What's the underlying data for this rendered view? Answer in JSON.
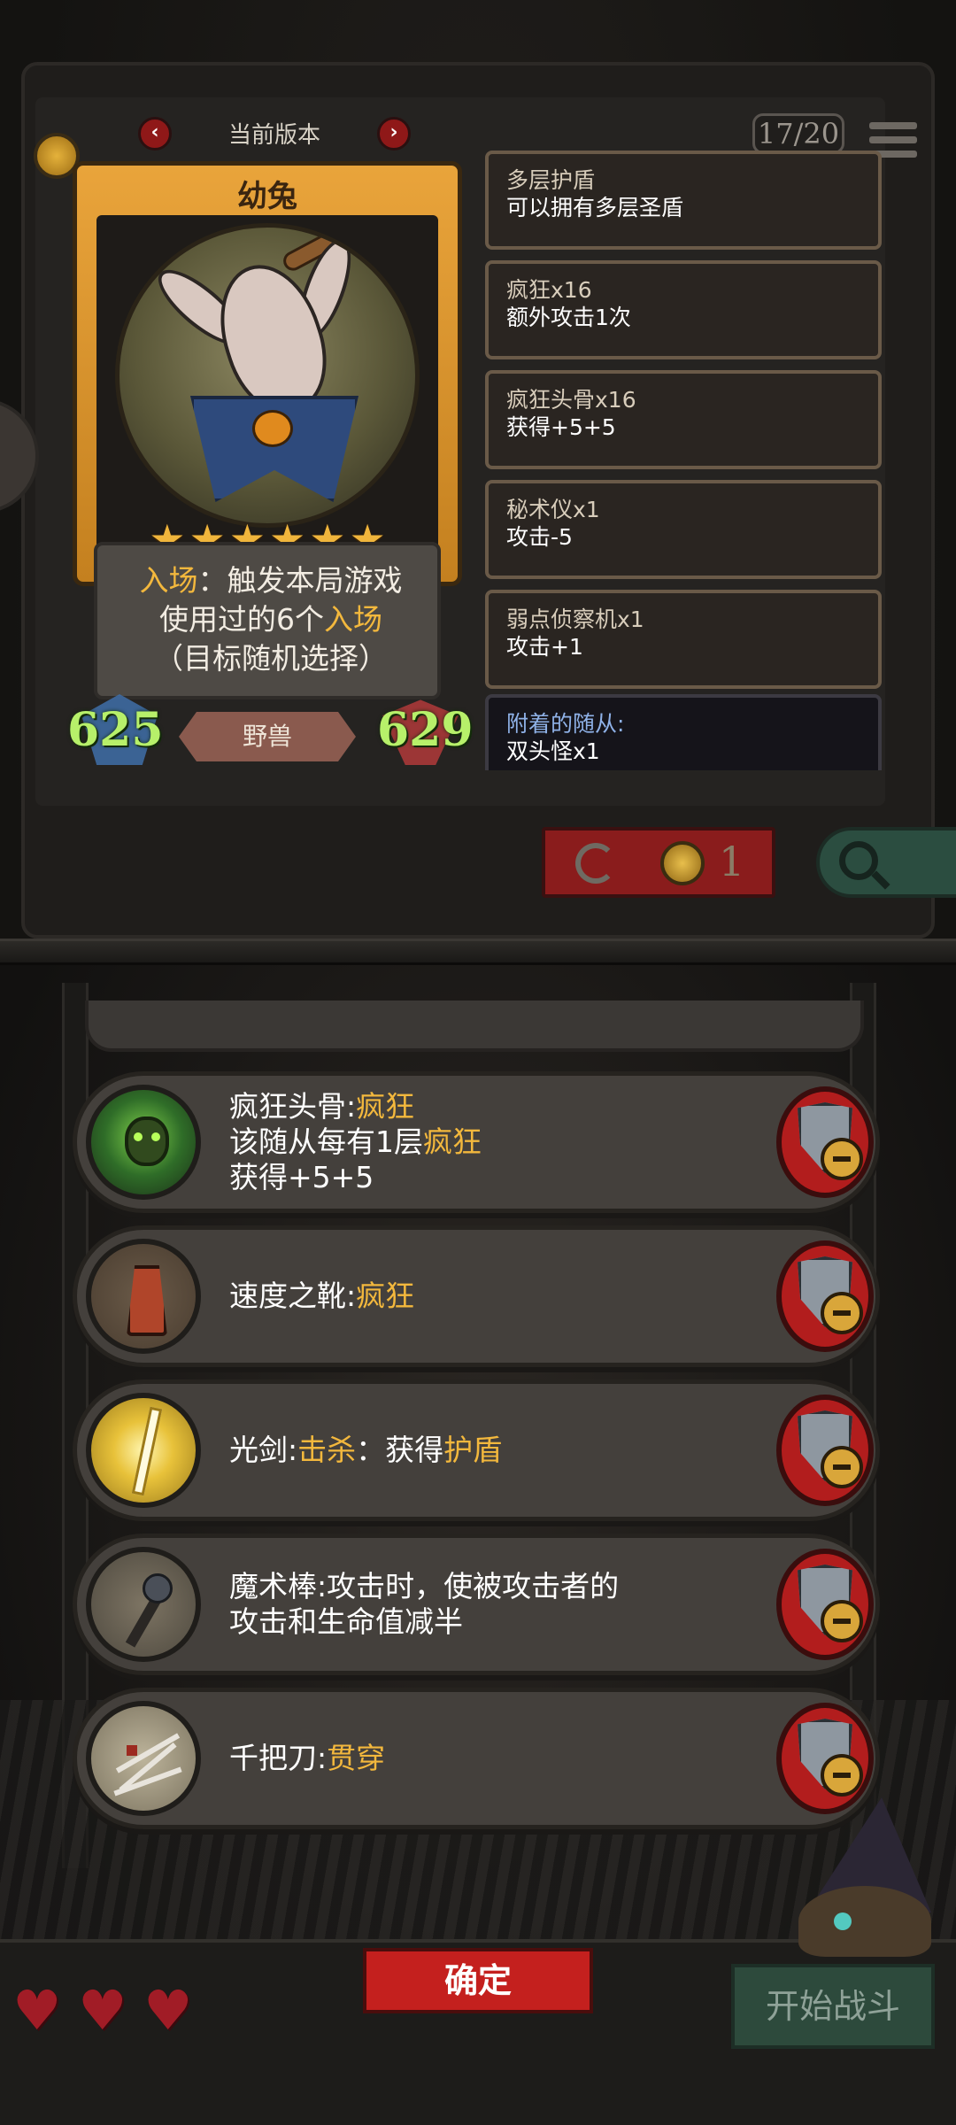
{
  "version": {
    "label": "当前版本",
    "prev_icon": "chevron-left-icon",
    "next_icon": "chevron-right-icon"
  },
  "hud": {
    "counter": "17/20",
    "menu_icon": "menu-icon"
  },
  "card": {
    "name": "幼兔",
    "stars": 6,
    "star_glyphs": [
      "★",
      "★",
      "★",
      "★",
      "★",
      "★"
    ],
    "desc_kw1": "入场",
    "desc_part1": "：触发本局游戏",
    "desc_part2": "使用过的6个",
    "desc_kw2": "入场",
    "desc_line3": "（目标随机选择）",
    "attack": "625",
    "health": "629",
    "tribe": "野兽"
  },
  "buffs": [
    {
      "title": "多层护盾",
      "desc": "可以拥有多层圣盾"
    },
    {
      "title": "疯狂x16",
      "desc": "额外攻击1次"
    },
    {
      "title": "疯狂头骨x16",
      "desc": "获得+5+5"
    },
    {
      "title": "秘术仪x1",
      "desc": "攻击-5"
    },
    {
      "title": "弱点侦察机x1",
      "desc": "攻击+1"
    },
    {
      "title": "附着的随从:",
      "desc": "双头怪x1"
    }
  ],
  "reroll": {
    "cost": "1",
    "icon": "refresh-icon",
    "coin_icon": "coin-icon"
  },
  "search": {
    "icon": "search-icon"
  },
  "equipment": [
    {
      "name": "疯狂头骨:",
      "kw": "疯狂",
      "line2_a": "该随从每有1层",
      "line2_kw": "疯狂",
      "line3": "获得+5+5",
      "icon": "green-skull-icon"
    },
    {
      "name": "速度之靴:",
      "kw": "疯狂",
      "icon": "boot-icon"
    },
    {
      "name": "光剑:",
      "kw": "击杀",
      "mid": "：获得",
      "kw2": "护盾",
      "icon": "light-sword-icon"
    },
    {
      "line1": "魔术棒:攻击时，使被攻击者的",
      "line2": "攻击和生命值减半",
      "icon": "magic-wand-icon"
    },
    {
      "name": "千把刀:",
      "kw": "贯穿",
      "icon": "knives-icon"
    }
  ],
  "lives": {
    "count": 3,
    "glyph": "♥",
    "icon": "heart-icon"
  },
  "buttons": {
    "confirm": "确定",
    "start": "开始战斗"
  },
  "colors": {
    "keyword": "#f3b83d",
    "stat": "#b7f06a",
    "confirm": "#c4201e",
    "remove": "#b21d1d"
  }
}
